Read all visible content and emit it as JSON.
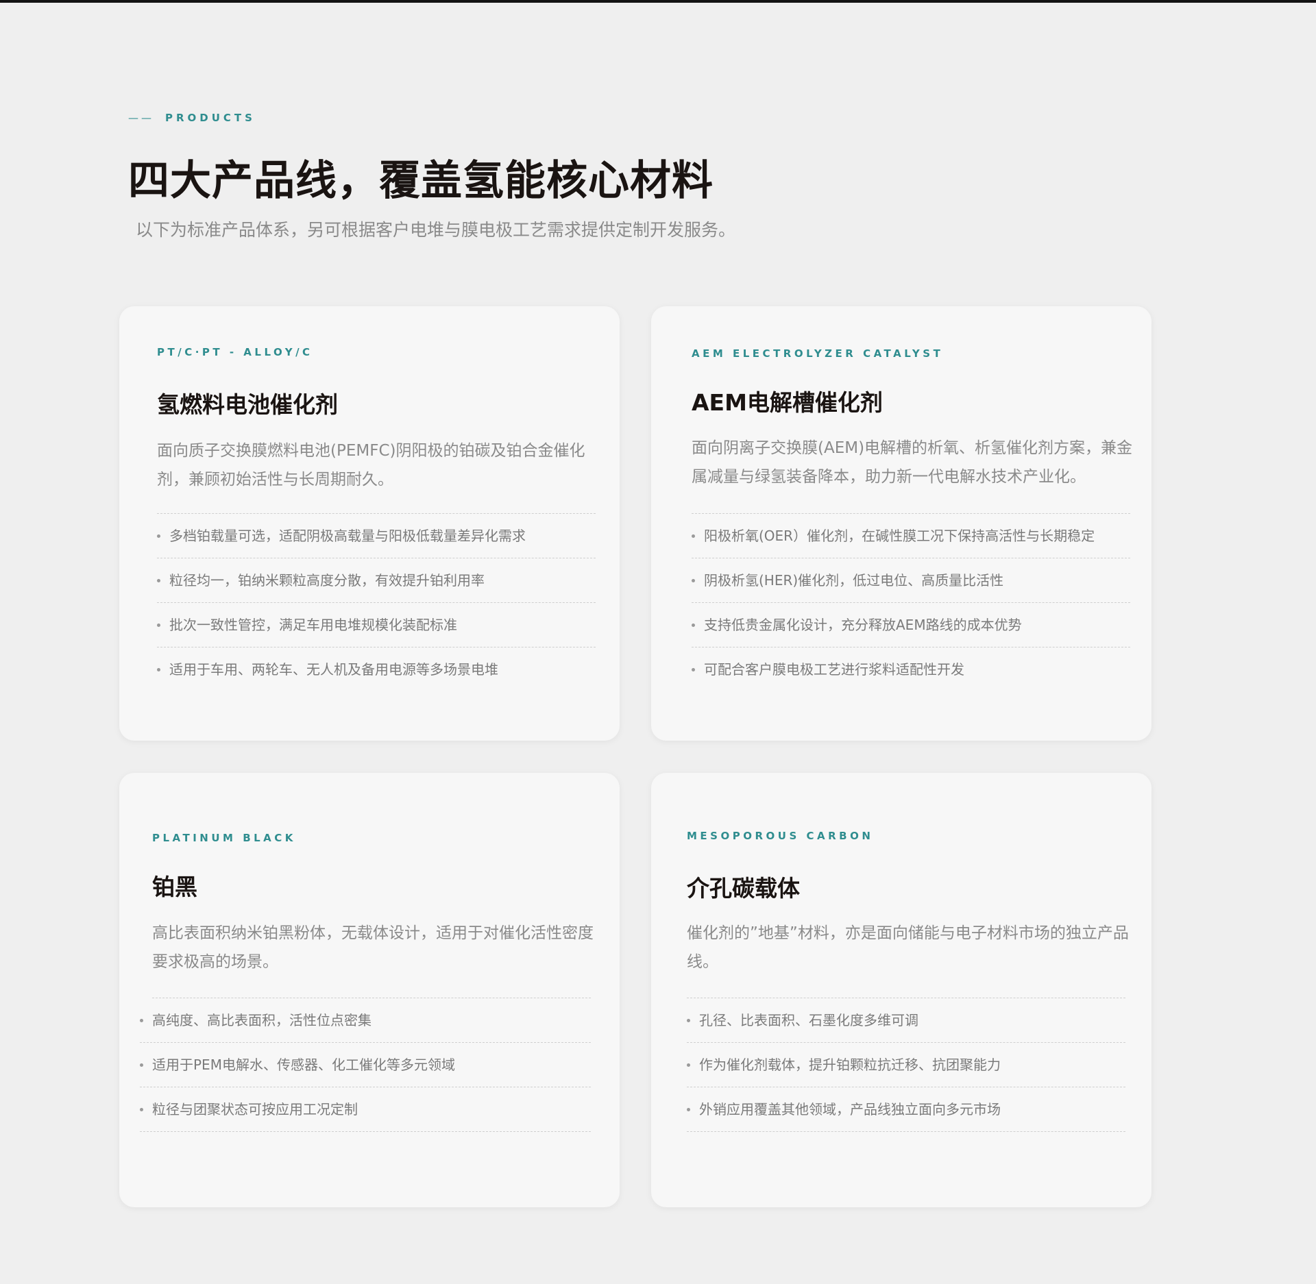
{
  "header": {
    "eyebrow_dash": "——",
    "eyebrow": "PRODUCTS",
    "title": "四大产品线，覆盖氢能核心材料",
    "subtitle": "以下为标准产品体系，另可根据客户电堆与膜电极工艺需求提供定制开发服务。"
  },
  "cards": [
    {
      "tag": "PT/C·PT - ALLOY/C",
      "title": "氢燃料电池催化剂",
      "description": "面向质子交换膜燃料电池(PEMFC)阴阳极的铂碳及铂合金催化剂，兼顾初始活性与长周期耐久。",
      "features": [
        "多档铂载量可选，适配阴极高载量与阳极低载量差异化需求",
        "粒径均一，铂纳米颗粒高度分散，有效提升铂利用率",
        "批次一致性管控，满足车用电堆规模化装配标准",
        "适用于车用、两轮车、无人机及备用电源等多场景电堆"
      ]
    },
    {
      "tag": "AEM ELECTROLYZER CATALYST",
      "title": "AEM电解槽催化剂",
      "description": "面向阴离子交换膜(AEM)电解槽的析氧、析氢催化剂方案，兼金属减量与绿氢装备降本，助力新一代电解水技术产业化。",
      "features": [
        "阳极析氧(OER）催化剂，在碱性膜工况下保持高活性与长期稳定",
        "阴极析氢(HER)催化剂，低过电位、高质量比活性",
        "支持低贵金属化设计，充分释放AEM路线的成本优势",
        "可配合客户膜电极工艺进行浆料适配性开发"
      ]
    },
    {
      "tag": "PLATINUM BLACK",
      "title": "铂黑",
      "description": "高比表面积纳米铂黑粉体，无载体设计，适用于对催化活性密度要求极高的场景。",
      "features": [
        "高纯度、高比表面积，活性位点密集",
        "适用于PEM电解水、传感器、化工催化等多元领域",
        "粒径与团聚状态可按应用工况定制"
      ]
    },
    {
      "tag": "MESOPOROUS CARBON",
      "title": "介孔碳载体",
      "description": "催化剂的”地基”材料，亦是面向储能与电子材料市场的独立产品线。",
      "features": [
        "孔径、比表面积、石墨化度多维可调",
        "作为催化剂载体，提升铂颗粒抗迁移、抗团聚能力",
        "外销应用覆盖其他领域，产品线独立面向多元市场"
      ]
    }
  ]
}
